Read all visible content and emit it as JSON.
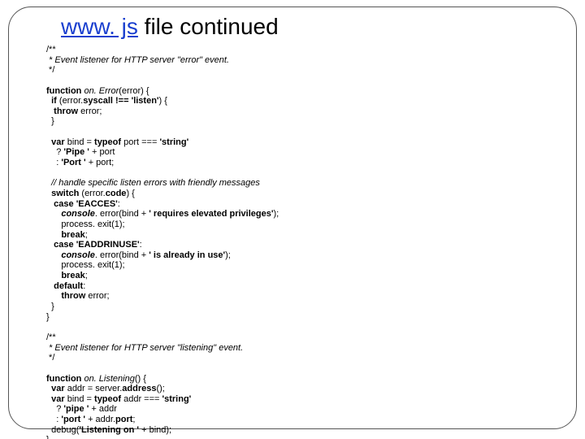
{
  "title": {
    "link": "www. js",
    "rest": " file continued"
  },
  "code": {
    "c1a": "/**",
    "c1b": " * Event listener for HTTP server \"error\" event.",
    "c1c": " */",
    "fn1": "function",
    "fn1name": " on. Error",
    "fn1rest": "(error) {",
    "if": "  if",
    "ifcond1": " (error.",
    "ifcond2": "syscall !== 'listen'",
    "ifcond3": ") {",
    "throw1a": "   throw",
    "throw1b": " error;",
    "close1": "  }",
    "var1a": "  var",
    "var1b": " bind = ",
    "var1c": "typeof",
    "var1d": " port === ",
    "var1e": "'string'",
    "t1a": "    ? ",
    "t1b": "'Pipe '",
    "t1c": " + port",
    "t2a": "    : ",
    "t2b": "'Port '",
    "t2c": " + port;",
    "cmt2": "  // handle specific listen errors with friendly messages",
    "sw1": "  switch",
    "sw2": " (error.",
    "sw3": "code",
    "sw4": ") {",
    "case1a": "   case 'EACCES'",
    "case1b": ":",
    "log1a": "      console",
    "log1b": ". error(bind + ",
    "log1c": "' requires elevated privileges'",
    "log1d": ");",
    "exit1": "      process. exit(1);",
    "br1a": "      break",
    "br1b": ";",
    "case2a": "   case 'EADDRINUSE'",
    "case2b": ":",
    "log2a": "      console",
    "log2b": ". error(bind + ",
    "log2c": "' is already in use'",
    "log2d": ");",
    "exit2": "      process. exit(1);",
    "br2a": "      break",
    "br2b": ";",
    "def1": "   default",
    "def2": ":",
    "throw2a": "      throw",
    "throw2b": " error;",
    "close2": "  }",
    "close3": "}",
    "c3a": "/**",
    "c3b": " * Event listener for HTTP server \"listening\" event.",
    "c3c": " */",
    "fn2a": "function",
    "fn2b": " on. Listening",
    "fn2c": "() {",
    "v2a": "  var",
    "v2b": " addr = server.",
    "v2c": "address",
    "v2d": "();",
    "v3a": "  var",
    "v3b": " bind = ",
    "v3c": "typeof",
    "v3d": " addr === ",
    "v3e": "'string'",
    "t3a": "    ? ",
    "t3b": "'pipe '",
    "t3c": " + addr",
    "t4a": "    : ",
    "t4b": "'port '",
    "t4c": " + addr.",
    "t4d": "port",
    "t4e": ";",
    "dbg1": "  debug(",
    "dbg2": "'Listening on '",
    "dbg3": " + bind);",
    "close4": "}"
  }
}
